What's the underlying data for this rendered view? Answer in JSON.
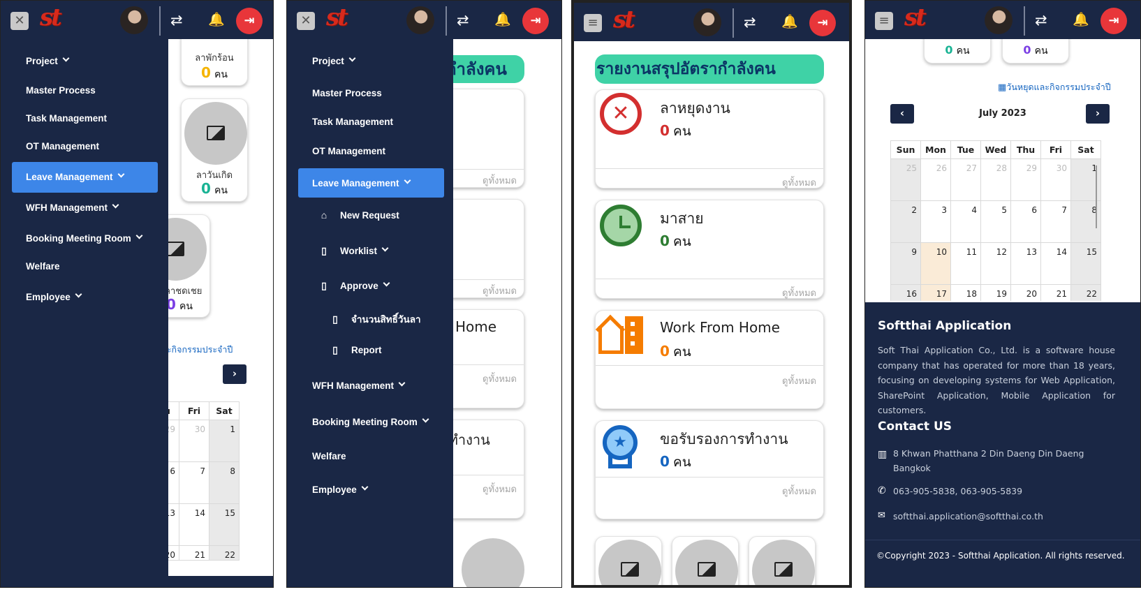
{
  "logo": "st",
  "menu": {
    "project": "Project",
    "master_process": "Master Process",
    "task_management": "Task Management",
    "ot_management": "OT Management",
    "leave_management": "Leave Management",
    "wfh_management": "WFH Management",
    "booking_meeting_room": "Booking Meeting Room",
    "welfare": "Welfare",
    "employee": "Employee",
    "leave_sub": {
      "new_request": "New Request",
      "worklist": "Worklist",
      "approve": "Approve",
      "entitlement": "จำนวนสิทธิ์วันลา",
      "report": "Report"
    }
  },
  "dashboard": {
    "title": "รายงานสรุปอัตรากำลังคน",
    "see_all": "ดูทั้งหมด",
    "unit": "คน",
    "cards": [
      {
        "label": "ลาหยุดงาน",
        "count": "0",
        "color": "#d32f2f",
        "icon": "cancel-icon"
      },
      {
        "label": "มาสาย",
        "count": "0",
        "color": "#2e7d32",
        "icon": "alarm-clock-icon"
      },
      {
        "label": "Work From Home",
        "count": "0",
        "color": "#f57c00",
        "icon": "home-building-icon"
      },
      {
        "label": "ขอรับรองการทำงาน",
        "count": "0",
        "color": "#1565c0",
        "icon": "award-badge-icon"
      }
    ],
    "leave_types": [
      {
        "label": "ลาพักร้อน",
        "count": "0",
        "color": "#f5b400"
      },
      {
        "label": "ลาวันเกิด",
        "count": "0",
        "color": "#1ab394"
      },
      {
        "label": "ลาชดเชย",
        "count": "0",
        "color": "#7b3fe4"
      }
    ]
  },
  "calendar": {
    "holiday_link": "วันหยุดและกิจกรรมประจำปี",
    "month": "July 2023",
    "weekdays": [
      "Sun",
      "Mon",
      "Tue",
      "Wed",
      "Thu",
      "Fri",
      "Sat"
    ],
    "weeks": [
      [
        "25",
        "26",
        "27",
        "28",
        "29",
        "30",
        "1"
      ],
      [
        "2",
        "3",
        "4",
        "5",
        "6",
        "7",
        "8"
      ],
      [
        "9",
        "10",
        "11",
        "12",
        "13",
        "14",
        "15"
      ],
      [
        "16",
        "17",
        "18",
        "19",
        "20",
        "21",
        "22"
      ]
    ]
  },
  "footer": {
    "company": "Softthai Application",
    "about": "Soft Thai Application Co., Ltd. is a software house company that has operated for more than 18 years, focusing on developing systems for Web Application, SharePoint Application, Mobile Application for customers.",
    "contact_title": "Contact US",
    "address": "8 Khwan Phatthana 2 Din Daeng Din Daeng Bangkok",
    "phone": "063-905-5838, 063-905-5839",
    "email": "softthai.application@softthai.co.th",
    "copyright": "©Copyright 2023 - Softthai Application. All rights reserved."
  },
  "fragments": {
    "leave_short": "ลาชดเชย",
    "cal_link_short": "ดและกิจกรรมประจำปี",
    "title_frag": "กำลังคน",
    "wfh_frag": "Home",
    "cert_frag": "รทำงาน",
    "hu": "hu",
    "d6": "6",
    "d13": "13"
  }
}
